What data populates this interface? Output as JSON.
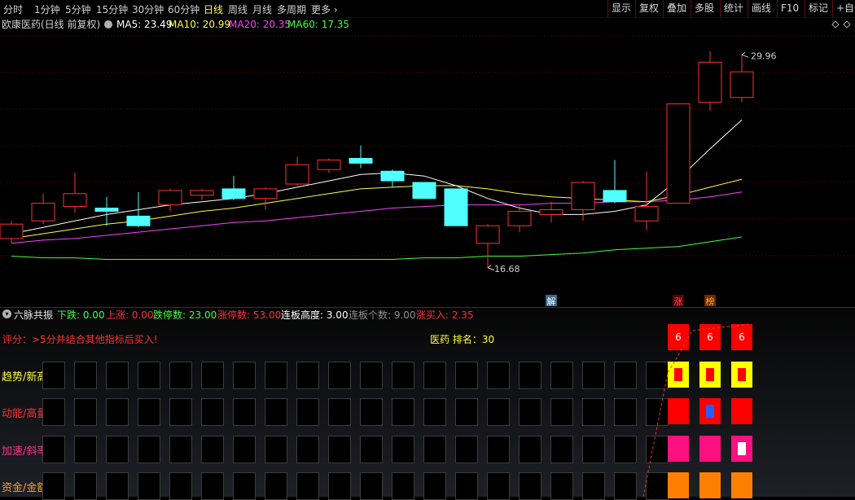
{
  "toolbar": {
    "periods": [
      "分时",
      "1分钟",
      "5分钟",
      "15分钟",
      "30分钟",
      "60分钟",
      "日线",
      "周线",
      "月线",
      "多周期",
      "更多"
    ],
    "active_period": "日线",
    "right_buttons": [
      "显示",
      "复权",
      "叠加",
      "多股",
      "统计",
      "画线",
      "F10",
      "标记",
      "+自选"
    ]
  },
  "chart_header": {
    "stock": "欧康医药(日线 前复权)",
    "ma": [
      {
        "label": "MA5: 23.49",
        "color": "#ffffff"
      },
      {
        "label": "MA10: 20.99",
        "color": "#ffff40"
      },
      {
        "label": "MA20: 20.35",
        "color": "#ff40ff"
      },
      {
        "label": "MA60: 17.35",
        "color": "#40ff40"
      }
    ]
  },
  "colors": {
    "up": "#ff3030",
    "down": "#50ffff",
    "ma5": "#ffffff",
    "ma10": "#ffff40",
    "ma20": "#ff40ff",
    "ma60": "#40ff40"
  },
  "chart_data": {
    "type": "candlestick",
    "ylim": [
      15.5,
      31.5
    ],
    "grid": true,
    "candles": [
      {
        "o": 18.5,
        "c": 19.4,
        "h": 19.6,
        "l": 18.2
      },
      {
        "o": 19.6,
        "c": 20.7,
        "h": 21.3,
        "l": 19.4
      },
      {
        "o": 20.5,
        "c": 21.3,
        "h": 22.6,
        "l": 20.1
      },
      {
        "o": 20.4,
        "c": 20.2,
        "h": 21.1,
        "l": 19.3
      },
      {
        "o": 19.9,
        "c": 19.3,
        "h": 21.4,
        "l": 19.2
      },
      {
        "o": 20.6,
        "c": 21.5,
        "h": 21.6,
        "l": 20.2
      },
      {
        "o": 21.2,
        "c": 21.5,
        "h": 21.6,
        "l": 20.9
      },
      {
        "o": 21.6,
        "c": 21.0,
        "h": 22.4,
        "l": 20.9
      },
      {
        "o": 21.0,
        "c": 21.6,
        "h": 21.7,
        "l": 20.3
      },
      {
        "o": 21.9,
        "c": 23.1,
        "h": 23.6,
        "l": 21.8
      },
      {
        "o": 22.8,
        "c": 23.4,
        "h": 23.5,
        "l": 22.6
      },
      {
        "o": 23.5,
        "c": 23.2,
        "h": 24.3,
        "l": 22.9
      },
      {
        "o": 22.7,
        "c": 22.1,
        "h": 22.8,
        "l": 21.7
      },
      {
        "o": 22.0,
        "c": 21.0,
        "h": 22.0,
        "l": 21.0
      },
      {
        "o": 21.6,
        "c": 19.3,
        "h": 21.6,
        "l": 19.3
      },
      {
        "o": 18.2,
        "c": 19.3,
        "h": 19.4,
        "l": 16.68
      },
      {
        "o": 19.3,
        "c": 20.2,
        "h": 20.6,
        "l": 18.9
      },
      {
        "o": 20.0,
        "c": 20.3,
        "h": 20.8,
        "l": 19.5
      },
      {
        "o": 20.3,
        "c": 22.0,
        "h": 22.1,
        "l": 19.6
      },
      {
        "o": 21.5,
        "c": 20.8,
        "h": 23.4,
        "l": 20.7
      },
      {
        "o": 19.6,
        "c": 20.5,
        "h": 22.7,
        "l": 19.0
      },
      {
        "o": 20.7,
        "c": 26.9,
        "h": 26.9,
        "l": 20.7
      },
      {
        "o": 27.0,
        "c": 29.5,
        "h": 30.2,
        "l": 26.5
      },
      {
        "o": 27.3,
        "c": 28.9,
        "h": 29.96,
        "l": 27.0
      }
    ],
    "ma5": [
      18.8,
      19.2,
      19.6,
      20.0,
      20.3,
      20.6,
      20.8,
      21.0,
      21.3,
      21.7,
      22.1,
      22.5,
      22.6,
      22.4,
      21.8,
      21.0,
      20.4,
      20.0,
      20.0,
      20.2,
      20.6,
      22.2,
      24.1,
      25.9
    ],
    "ma10": [
      18.5,
      18.8,
      19.1,
      19.4,
      19.6,
      19.9,
      20.2,
      20.4,
      20.7,
      21.0,
      21.3,
      21.6,
      21.7,
      21.8,
      21.8,
      21.6,
      21.3,
      21.1,
      21.0,
      20.9,
      20.8,
      21.2,
      21.7,
      22.2
    ],
    "ma20": [
      18.2,
      18.4,
      18.5,
      18.7,
      18.9,
      19.1,
      19.3,
      19.5,
      19.6,
      19.8,
      20.0,
      20.2,
      20.4,
      20.5,
      20.6,
      20.6,
      20.6,
      20.7,
      20.7,
      20.8,
      20.8,
      20.9,
      21.1,
      21.4
    ],
    "ma60": [
      17.4,
      17.3,
      17.3,
      17.2,
      17.2,
      17.2,
      17.2,
      17.2,
      17.2,
      17.2,
      17.2,
      17.2,
      17.2,
      17.3,
      17.3,
      17.4,
      17.4,
      17.5,
      17.6,
      17.8,
      17.9,
      18.0,
      18.3,
      18.6
    ],
    "high_label": "29.96",
    "low_label": "16.68",
    "markers": [
      {
        "index": 17,
        "text": "解",
        "bg": "#3a6a8a",
        "color": "#ffffff"
      },
      {
        "index": 21,
        "text": "涨",
        "bg": "#5a0000",
        "color": "#ff5050"
      },
      {
        "index": 22,
        "text": "榜",
        "bg": "#6a2a00",
        "color": "#ffaa30"
      }
    ]
  },
  "indicator": {
    "name": "六脉共振",
    "stats": [
      {
        "text": "下跌: 0.00",
        "color": "#40ff40"
      },
      {
        "text": "上涨: 0.00",
        "color": "#ff3030"
      },
      {
        "text": "跌停数: 23.00",
        "color": "#40ff40"
      },
      {
        "text": "涨停数: 53.00",
        "color": "#ff3030"
      },
      {
        "text": "连板高度: 3.00",
        "color": "#ffffff"
      },
      {
        "text": "连板个数: 9.00",
        "color": "#909090"
      },
      {
        "text": "涨买入: 2.35",
        "color": "#ff3030"
      }
    ],
    "score_text": "评分：>5分并结合其他指标后买入!",
    "rank_text": "医药 排名：30",
    "rows": [
      {
        "label": "趋势/新高",
        "color": "#ffff40"
      },
      {
        "label": "动能/高量",
        "color": "#ff3030"
      },
      {
        "label": "加速/斜率",
        "color": "#ff3090"
      },
      {
        "label": "资金/金额",
        "color": "#ffa020"
      }
    ],
    "score_values": [
      "6",
      "6",
      "6"
    ]
  }
}
